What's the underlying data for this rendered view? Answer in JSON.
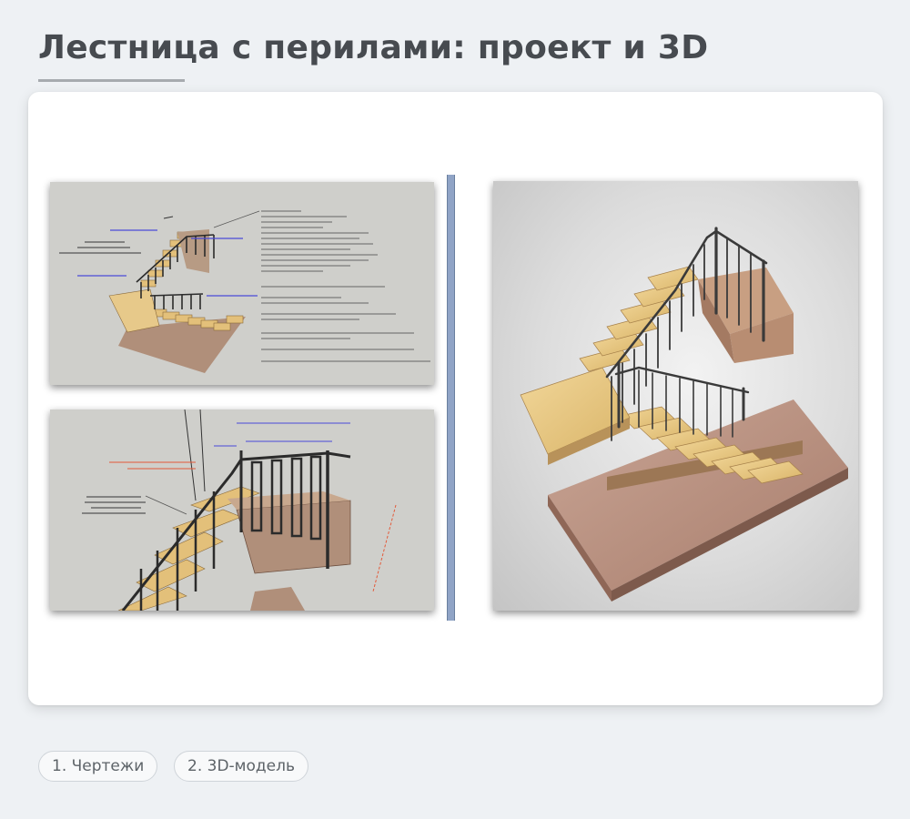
{
  "page": {
    "title": "Лестница с перилами: проект и 3D"
  },
  "gallery": {
    "images": [
      {
        "name": "drawing-assembly-scheme"
      },
      {
        "name": "drawing-railing-detail"
      },
      {
        "name": "stair-3d-render"
      }
    ]
  },
  "tabs": [
    {
      "label": "1. Чертежи"
    },
    {
      "label": "2. 3D-модель"
    }
  ],
  "colors": {
    "accent_divider": "#90a4c6",
    "background": "#eef1f4",
    "card": "#ffffff"
  }
}
